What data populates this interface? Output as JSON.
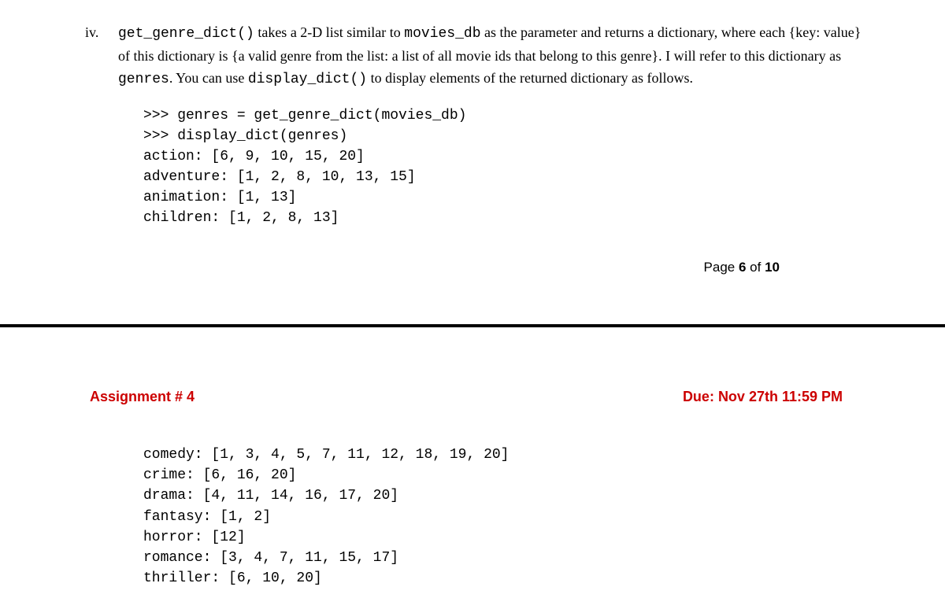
{
  "item": {
    "numeral": "iv.",
    "desc_parts": {
      "fn1": "get_genre_dict()",
      "t1": " takes a 2-D list similar to ",
      "v1": "movies_db",
      "t2": " as the parameter and returns a dictionary, where each {key: value} of this dictionary is {a valid genre from the list: a list of all movie ids that belong to this genre}. I will refer to this dictionary as ",
      "v2": "genres",
      "t3": ". You can use ",
      "fn2": "display_dict()",
      "t4": " to display elements of the returned dictionary as follows."
    }
  },
  "code_top": ">>> genres = get_genre_dict(movies_db)\n>>> display_dict(genres)\naction: [6, 9, 10, 15, 20]\nadventure: [1, 2, 8, 10, 13, 15]\nanimation: [1, 13]\nchildren: [1, 2, 8, 13]",
  "page_label": {
    "prefix": "Page ",
    "current": "6",
    "of": " of ",
    "total": "10"
  },
  "header": {
    "assignment": "Assignment # 4",
    "due": "Due: Nov 27th 11:59 PM"
  },
  "code_bottom": "comedy: [1, 3, 4, 5, 7, 11, 12, 18, 19, 20]\ncrime: [6, 16, 20]\ndrama: [4, 11, 14, 16, 17, 20]\nfantasy: [1, 2]\nhorror: [12]\nromance: [3, 4, 7, 11, 15, 17]\nthriller: [6, 10, 20]"
}
